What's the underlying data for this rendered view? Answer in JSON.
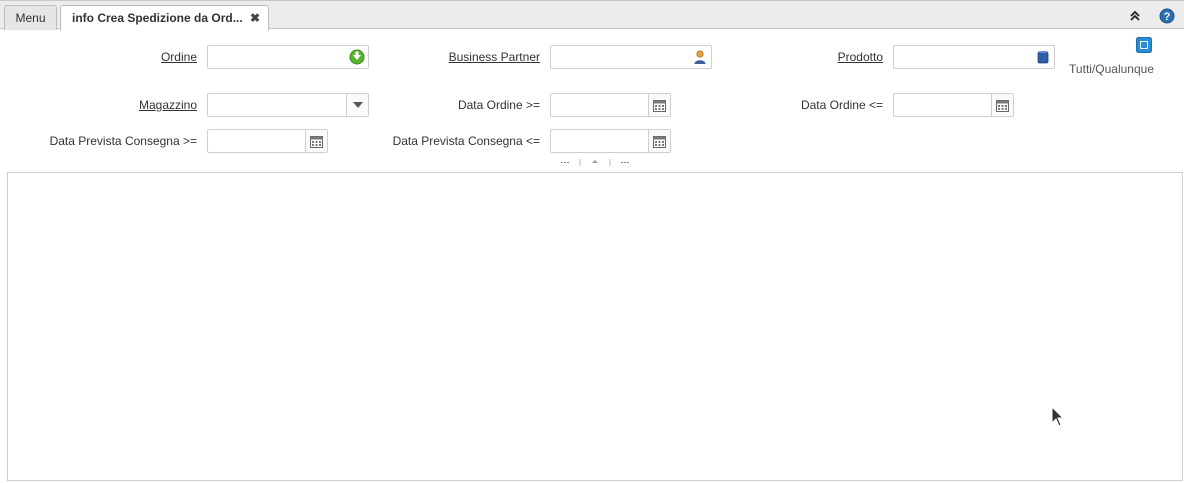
{
  "tabs": {
    "menu_label": "Menu",
    "active_label": "info Crea Spedizione da Ord...",
    "close_glyph": "✖"
  },
  "form": {
    "ordine": {
      "label": "Ordine",
      "value": ""
    },
    "business_partner": {
      "label": "Business Partner",
      "value": ""
    },
    "prodotto": {
      "label": "Prodotto",
      "value": ""
    },
    "tutti_qualunque": {
      "label": "Tutti/Qualunque",
      "checked": true
    },
    "magazzino": {
      "label": "Magazzino",
      "value": ""
    },
    "data_ordine_da": {
      "label": "Data Ordine >=",
      "value": ""
    },
    "data_ordine_a": {
      "label": "Data Ordine <=",
      "value": ""
    },
    "data_prevista_da": {
      "label": "Data Prevista Consegna >=",
      "value": ""
    },
    "data_prevista_a": {
      "label": "Data Prevista Consegna <=",
      "value": ""
    }
  },
  "icons": {
    "ordine": "order-lookup-icon",
    "bpartner": "business-partner-icon",
    "prodotto": "product-icon",
    "calendar": "calendar-icon",
    "combo": "chevron-down-icon",
    "collapse": "double-chevron-up-icon",
    "help": "help-icon"
  },
  "colors": {
    "accent_blue": "#2a8dd4",
    "order_green": "#4a9a2a"
  }
}
